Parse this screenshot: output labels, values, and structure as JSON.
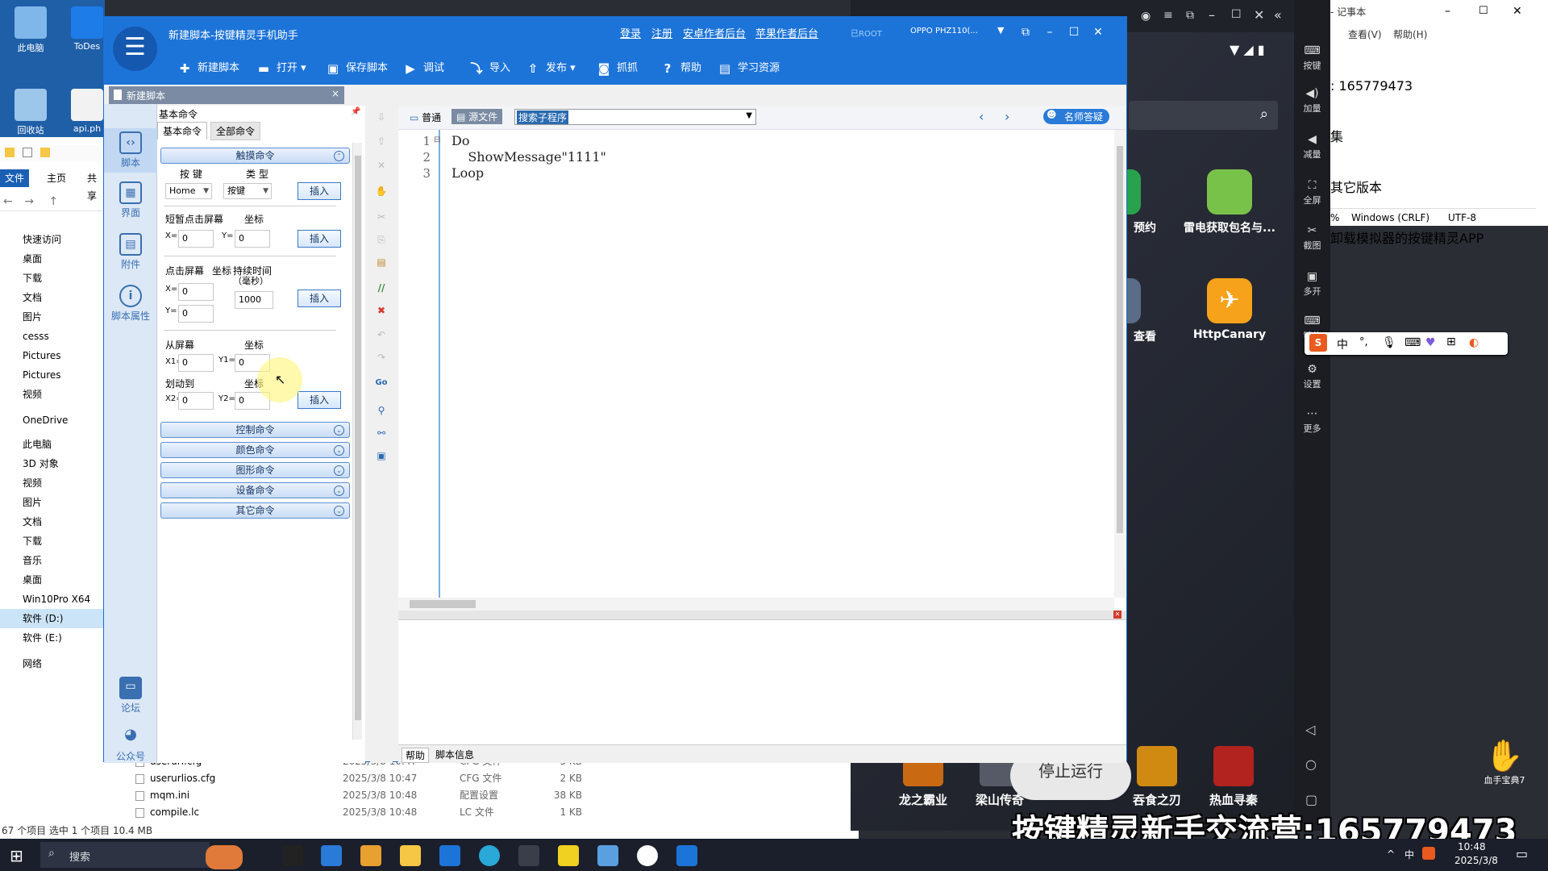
{
  "desktop": {
    "icons": [
      {
        "label": "此电脑"
      },
      {
        "label": "ToDes"
      },
      {
        "label": "回收站"
      },
      {
        "label": "api.ph"
      }
    ]
  },
  "explorer": {
    "tabs": [
      "文件",
      "主页",
      "共享"
    ],
    "tree": [
      "快速访问",
      "桌面",
      "下载",
      "文档",
      "图片",
      "cesss",
      "Pictures",
      "Pictures",
      "视频",
      "OneDrive",
      "此电脑",
      "3D 对象",
      "视频",
      "图片",
      "文档",
      "下载",
      "音乐",
      "桌面",
      "Win10Pro X64",
      "软件 (D:)",
      "软件 (E:)",
      "网络"
    ],
    "files": [
      {
        "name": "userurl.cfg",
        "date": "2025/3/8 10:47",
        "type": "CFG 文件",
        "size": "5 KB"
      },
      {
        "name": "userurlios.cfg",
        "date": "2025/3/8 10:47",
        "type": "CFG 文件",
        "size": "2 KB"
      },
      {
        "name": "mqm.ini",
        "date": "2025/3/8 10:48",
        "type": "配置设置",
        "size": "38 KB"
      },
      {
        "name": "compile.lc",
        "date": "2025/3/8 10:48",
        "type": "LC 文件",
        "size": "1 KB"
      }
    ],
    "status": "67 个项目    选中 1 个项目  10.4 MB"
  },
  "main": {
    "title": "新建脚本-按键精灵手机助手",
    "links": [
      "登录",
      "注册",
      "安卓作者后台",
      "苹果作者后台"
    ],
    "root_label": "已ROOT",
    "device": "OPPO  PHZ110(...",
    "toolbar": [
      "新建脚本",
      "打开",
      "保存脚本",
      "调试",
      "导入",
      "发布",
      "抓抓",
      "帮助",
      "学习资源"
    ],
    "doc_tab": "新建脚本",
    "rail": [
      "脚本",
      "界面",
      "附件",
      "脚本属性",
      "论坛",
      "公众号"
    ],
    "panel": {
      "title": "基本命令",
      "tabs": [
        "基本命令",
        "全部命令"
      ],
      "touch_header": "触摸命令",
      "key_label": "按 键",
      "type_label": "类 型",
      "key_value": "Home",
      "type_value": "按键",
      "insert": "插入",
      "tap_label": "短暂点击屏幕",
      "coord_label": "坐标",
      "x_label": "X=",
      "y_label": "Y=",
      "zero": "0",
      "press_label": "点击屏幕",
      "duration_label": "持续时间",
      "duration_unit": "（毫秒）",
      "duration_value": "1000",
      "from_label": "从屏幕",
      "to_label": "划动到",
      "x1_label": "X1=",
      "y1_label": "Y1=",
      "x2_label": "X2=",
      "y2_label": "Y2=",
      "groups": [
        "控制命令",
        "颜色命令",
        "图形命令",
        "设备命令",
        "其它命令"
      ]
    },
    "editor": {
      "mode_normal": "普通",
      "mode_source": "源文件",
      "search": "搜索子程序",
      "help_badge": "名师答疑",
      "lines": [
        "Do",
        "    ShowMessage\"1111\"",
        "Loop"
      ],
      "bottom_tabs": [
        "帮助",
        "脚本信息"
      ]
    }
  },
  "emulator": {
    "side": [
      "按键",
      "加量",
      "减量",
      "全屏",
      "截图",
      "多开",
      "键位",
      "设置",
      "更多"
    ],
    "apps": [
      {
        "label": "预约"
      },
      {
        "label": "雷电获取包名与..."
      },
      {
        "label": "查看"
      },
      {
        "label": "HttpCanary"
      }
    ],
    "games": [
      "龙之霸业",
      "梁山传奇",
      "停止运行",
      "吞食之刃",
      "热血寻秦"
    ],
    "ime": [
      "中",
      "°,",
      "⊞"
    ],
    "xuezhu": "血手宝典7"
  },
  "notepad": {
    "title": "- 记事本",
    "menu": [
      "查看(V)",
      "帮助(H)"
    ],
    "lines": [
      ": 165779473",
      "集",
      "其它版本",
      "卸载模拟器的按键精灵APP"
    ],
    "status": [
      "%",
      "Windows (CRLF)",
      "UTF-8"
    ]
  },
  "taskbar": {
    "search": "搜索",
    "time": "10:48",
    "date": "2025/3/8",
    "tray": [
      "中"
    ]
  },
  "watermark": "按键精灵新手交流营:165779473"
}
